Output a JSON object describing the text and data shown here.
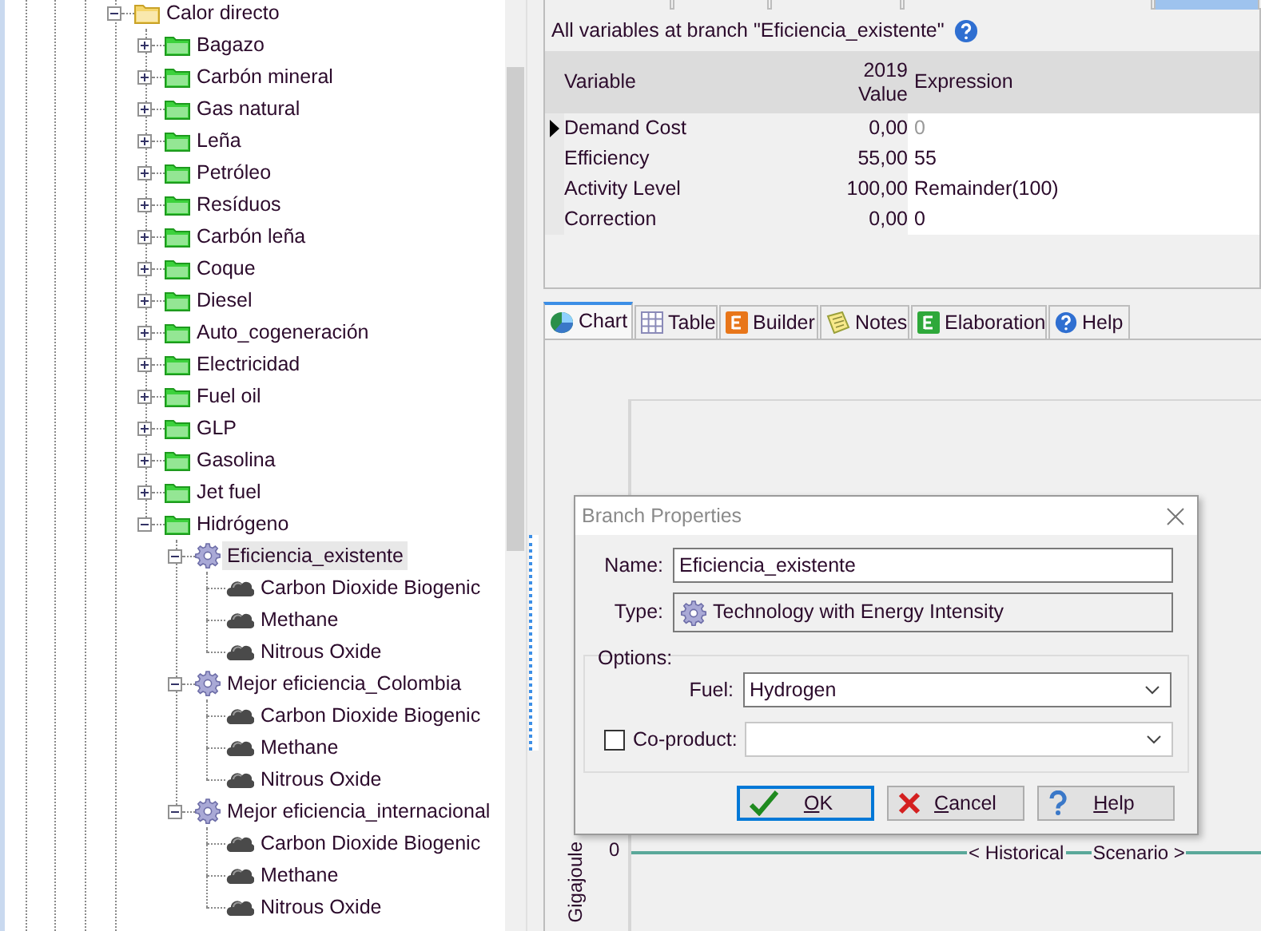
{
  "top_tabs": [
    {
      "selected": false
    },
    {
      "selected": false
    },
    {
      "selected": false
    },
    {
      "selected": false
    },
    {
      "selected": true
    }
  ],
  "tree": {
    "items": [
      {
        "label": "Calor directo",
        "kind": "folder",
        "expanded": true,
        "selected": false,
        "children": [
          {
            "label": "Bagazo",
            "kind": "category",
            "expanded": false,
            "selected": false
          },
          {
            "label": "Carbón mineral",
            "kind": "category",
            "expanded": false,
            "selected": false
          },
          {
            "label": "Gas natural",
            "kind": "category",
            "expanded": false,
            "selected": false
          },
          {
            "label": "Leña",
            "kind": "category",
            "expanded": false,
            "selected": false
          },
          {
            "label": "Petróleo",
            "kind": "category",
            "expanded": false,
            "selected": false
          },
          {
            "label": "Resíduos",
            "kind": "category",
            "expanded": false,
            "selected": false
          },
          {
            "label": "Carbón leña",
            "kind": "category",
            "expanded": false,
            "selected": false
          },
          {
            "label": "Coque",
            "kind": "category",
            "expanded": false,
            "selected": false
          },
          {
            "label": "Diesel",
            "kind": "category",
            "expanded": false,
            "selected": false
          },
          {
            "label": "Auto_cogeneración",
            "kind": "category",
            "expanded": false,
            "selected": false
          },
          {
            "label": "Electricidad",
            "kind": "category",
            "expanded": false,
            "selected": false
          },
          {
            "label": "Fuel oil",
            "kind": "category",
            "expanded": false,
            "selected": false
          },
          {
            "label": "GLP",
            "kind": "category",
            "expanded": false,
            "selected": false
          },
          {
            "label": "Gasolina",
            "kind": "category",
            "expanded": false,
            "selected": false
          },
          {
            "label": "Jet fuel",
            "kind": "category",
            "expanded": false,
            "selected": false
          },
          {
            "label": "Hidrógeno",
            "kind": "category",
            "expanded": true,
            "selected": false,
            "children": [
              {
                "label": "Eficiencia_existente",
                "kind": "technology",
                "expanded": true,
                "selected": true,
                "children": [
                  {
                    "label": "Carbon Dioxide Biogenic",
                    "kind": "effect",
                    "selected": false
                  },
                  {
                    "label": "Methane",
                    "kind": "effect",
                    "selected": false
                  },
                  {
                    "label": "Nitrous Oxide",
                    "kind": "effect",
                    "selected": false
                  }
                ]
              },
              {
                "label": "Mejor eficiencia_Colombia",
                "kind": "technology",
                "expanded": true,
                "selected": false,
                "children": [
                  {
                    "label": "Carbon Dioxide Biogenic",
                    "kind": "effect",
                    "selected": false
                  },
                  {
                    "label": "Methane",
                    "kind": "effect",
                    "selected": false
                  },
                  {
                    "label": "Nitrous Oxide",
                    "kind": "effect",
                    "selected": false
                  }
                ]
              },
              {
                "label": "Mejor eficiencia_internacional",
                "kind": "technology",
                "expanded": true,
                "selected": false,
                "children": [
                  {
                    "label": "Carbon Dioxide Biogenic",
                    "kind": "effect",
                    "selected": false
                  },
                  {
                    "label": "Methane",
                    "kind": "effect",
                    "selected": false
                  },
                  {
                    "label": "Nitrous Oxide",
                    "kind": "effect",
                    "selected": false
                  }
                ]
              }
            ]
          }
        ]
      }
    ]
  },
  "variables": {
    "title": "All variables at branch \"Eficiencia_existente\"",
    "columns": [
      {
        "lines": [
          "Variable"
        ]
      },
      {
        "lines": [
          "2019",
          "Value"
        ]
      },
      {
        "lines": [
          "Expression"
        ]
      }
    ],
    "rows": [
      {
        "variable": "Demand Cost",
        "value": "0,00",
        "expression": "0",
        "selected": true,
        "inherited": true
      },
      {
        "variable": "Efficiency",
        "value": "55,00",
        "expression": "55",
        "selected": false,
        "inherited": false
      },
      {
        "variable": "Activity Level",
        "value": "100,00",
        "expression": "Remainder(100)",
        "selected": false,
        "inherited": false
      },
      {
        "variable": "Correction",
        "value": "0,00",
        "expression": "0",
        "selected": false,
        "inherited": false
      }
    ]
  },
  "bottom_tabs": [
    {
      "label": "Chart",
      "kind": "chart",
      "selected": true
    },
    {
      "label": "Table",
      "kind": "table",
      "selected": false
    },
    {
      "label": "Builder",
      "kind": "builder",
      "selected": false
    },
    {
      "label": "Notes",
      "kind": "notes",
      "selected": false
    },
    {
      "label": "Elaboration",
      "kind": "elaboration",
      "selected": false
    },
    {
      "label": "Help",
      "kind": "help",
      "selected": false
    }
  ],
  "chart": {
    "y_label": "Gigajoule",
    "y_tick": "0",
    "markers": [
      "< Historical",
      "Scenario >"
    ]
  },
  "dialog": {
    "title": "Branch Properties",
    "name": {
      "label": "Name:",
      "value": "Eficiencia_existente"
    },
    "type": {
      "label": "Type:",
      "value": "Technology with Energy Intensity"
    },
    "options": {
      "label": "Options:",
      "fuel": {
        "label": "Fuel:",
        "value": "Hydrogen"
      },
      "coproduct": {
        "label": "Co-product:",
        "checked": false
      }
    },
    "buttons": [
      {
        "label": "OK",
        "kind": "ok",
        "default": true
      },
      {
        "label": "Cancel",
        "kind": "cancel",
        "default": false
      },
      {
        "label": "Help",
        "kind": "help",
        "default": false
      }
    ]
  }
}
